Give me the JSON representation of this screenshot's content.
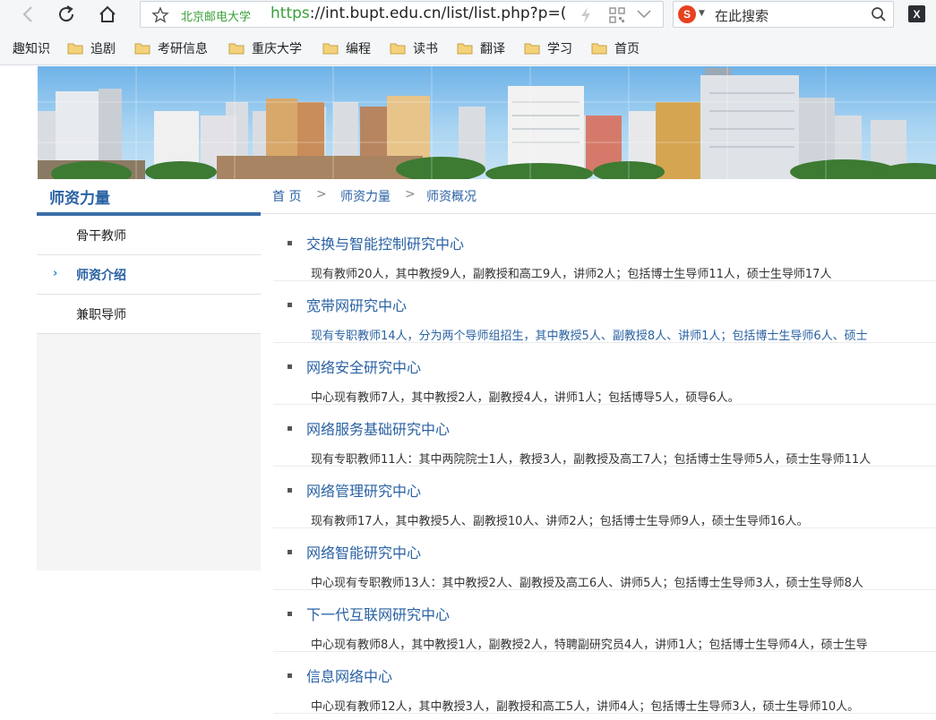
{
  "browser": {
    "site_name": "北京邮电大学",
    "url_protocol": "https",
    "url_rest": "://int.bupt.edu.cn/list/list.php?p=(",
    "search_engine_letter": "S",
    "search_placeholder": "在此搜索",
    "extension_letter": "X"
  },
  "bookmarks": [
    "趣知识",
    "追剧",
    "考研信息",
    "重庆大学",
    "编程",
    "读书",
    "翻译",
    "学习",
    "首页"
  ],
  "sidebar": {
    "title": "师资力量",
    "items": [
      {
        "label": "骨干教师"
      },
      {
        "label": "师资介绍"
      },
      {
        "label": "兼职导师"
      }
    ]
  },
  "breadcrumb": {
    "items": [
      "首 页",
      "师资力量",
      "师资概况"
    ],
    "separator": ">"
  },
  "entries": [
    {
      "title": "交换与智能控制研究中心",
      "desc": "现有教师20人，其中教授9人，副教授和高工9人，讲师2人；包括博士生导师11人，硕士生导师17人"
    },
    {
      "title": "宽带网研究中心",
      "desc": "现有专职教师14人，分为两个导师组招生，其中教授5人、副教授8人、讲师1人；包括博士生导师6人、硕士"
    },
    {
      "title": "网络安全研究中心",
      "desc": "中心现有教师7人，其中教授2人，副教授4人，讲师1人；包括博导5人，硕导6人。"
    },
    {
      "title": "网络服务基础研究中心",
      "desc": "现有专职教师11人：其中两院院士1人，教授3人，副教授及高工7人；包括博士生导师5人，硕士生导师11人"
    },
    {
      "title": "网络管理研究中心",
      "desc": "现有教师17人，其中教授5人、副教授10人、讲师2人；包括博士生导师9人，硕士生导师16人。"
    },
    {
      "title": "网络智能研究中心",
      "desc": "中心现有专职教师13人：其中教授2人、副教授及高工6人、讲师5人；包括博士生导师3人，硕士生导师8人"
    },
    {
      "title": "下一代互联网研究中心",
      "desc": "中心现有教师8人，其中教授1人，副教授2人，特聘副研究员4人，讲师1人；包括博士生导师4人，硕士生导"
    },
    {
      "title": "信息网络中心",
      "desc": "中心现有教师12人，其中教授3人，副教授和高工5人，讲师4人；包括博士生导师3人，硕士生导师10人。"
    }
  ]
}
